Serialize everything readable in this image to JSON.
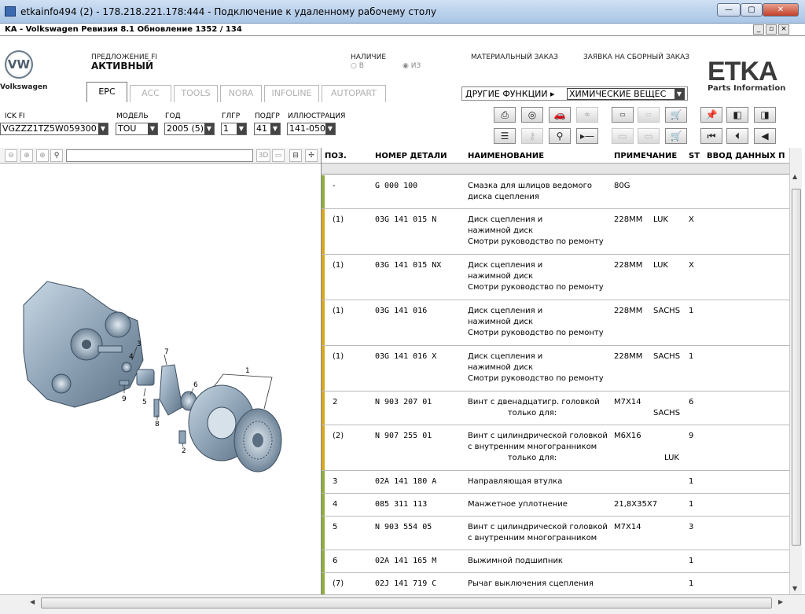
{
  "rdp": {
    "title": "etkainfo494 (2) - 178.218.221.178:444 - Подключение к удаленному рабочему столу"
  },
  "app": {
    "title": "KA - Volkswagen Ревизия 8.1 Обновление 1352 / 134"
  },
  "header": {
    "brand": "Volkswagen",
    "offer_label": "ПРЕДЛОЖЕНИЕ FI",
    "offer_value": "АКТИВНЫЙ",
    "stock_label": "НАЛИЧИЕ",
    "stock_opt_in": "В",
    "stock_opt_from": "ИЗ",
    "material_order": "МАТЕРИАЛЬНЫЙ ЗАКАЗ",
    "assembly_order": "ЗАЯВКА НА СБОРНЫЙ ЗАКАЗ",
    "logo_main": "ETKA",
    "logo_sub": "Parts Information"
  },
  "tabs": [
    "EPC",
    "ACC",
    "TOOLS",
    "NORA",
    "INFOLINE",
    "AUTOPART"
  ],
  "other_functions": {
    "label": "ДРУГИЕ ФУНКЦИИ ▸",
    "value": "ХИМИЧЕСКИЕ ВЕЩЕС"
  },
  "selectors": {
    "vin_label": "ICK FI",
    "vin_value": "VGZZZ1TZ5W059300",
    "model_label": "МОДЕЛЬ",
    "model_value": "TOU",
    "year_label": "ГОД",
    "year_value": "2005 (5)",
    "mg_label": "ГЛГР",
    "mg_value": "1",
    "sg_label": "ПОДГР",
    "sg_value": "41",
    "ill_label": "ИЛЛЮСТРАЦИЯ",
    "ill_value": "141-050"
  },
  "viewer": {
    "btn_3d": "3D"
  },
  "columns": {
    "pos": "ПОЗ.",
    "part": "НОМЕР ДЕТАЛИ",
    "name": "НАИМЕНОВАНИЕ",
    "note": "ПРИМЕЧАНИЕ",
    "st": "ST",
    "input": "ВВОД ДАННЫХ П"
  },
  "illustration_callouts": [
    "1",
    "2",
    "3",
    "4",
    "5",
    "6",
    "7",
    "8",
    "9"
  ],
  "rows": [
    {
      "pos": "-",
      "part": "G   000 100",
      "name": [
        "Смазка для шлицов ведомого",
        "диска сцепления"
      ],
      "note": "80G",
      "note2": "",
      "st": "",
      "color": "#8fae3c"
    },
    {
      "pos": "(1)",
      "part": "03G 141 015 N",
      "name": [
        "Диск сцепления и",
        "нажимной диск",
        "Смотри руководство по ремонту"
      ],
      "note": "228MM",
      "note2": "LUK",
      "st": "X",
      "color": "#d8a820"
    },
    {
      "pos": "(1)",
      "part": "03G 141 015 NX",
      "name": [
        "Диск сцепления и",
        "нажимной диск",
        "Смотри руководство по ремонту"
      ],
      "note": "228MM",
      "note2": "LUK",
      "st": "X",
      "color": "#d8a820"
    },
    {
      "pos": "(1)",
      "part": "03G 141 016",
      "name": [
        "Диск сцепления и",
        "нажимной диск",
        "Смотри руководство по ремонту"
      ],
      "note": "228MM",
      "note2": "SACHS",
      "st": "1",
      "color": "#d8a820"
    },
    {
      "pos": "(1)",
      "part": "03G 141 016  X",
      "name": [
        "Диск сцепления и",
        "нажимной диск",
        "Смотри руководство по ремонту"
      ],
      "note": "228MM",
      "note2": "SACHS",
      "st": "1",
      "color": "#d8a820"
    },
    {
      "pos": "2",
      "part": "N   903 207 01",
      "name": [
        "Винт с двенадцатигр. головкой",
        "                только для:"
      ],
      "note": "M7X14",
      "note2": "SACHS",
      "st": "6",
      "color": "#d8a820"
    },
    {
      "pos": "(2)",
      "part": "N   907 255 01",
      "name": [
        "Винт с цилиндрической головкой",
        "с внутренним многогранником",
        "                только для:"
      ],
      "note": "M6X16",
      "note2": "LUK",
      "st": "9",
      "color": "#d8a820"
    },
    {
      "pos": "3",
      "part": "02A 141 180  A",
      "name": [
        "Направляющая втулка"
      ],
      "note": "",
      "note2": "",
      "st": "1",
      "color": "#8fae3c"
    },
    {
      "pos": "4",
      "part": "085 311 113",
      "name": [
        "Манжетное уплотнение"
      ],
      "note": "21,8X35X7",
      "note2": "",
      "st": "1",
      "color": "#8fae3c"
    },
    {
      "pos": "5",
      "part": "N   903 554 05",
      "name": [
        "Винт с цилиндрической головкой",
        "с внутренним многогранником"
      ],
      "note": "M7X14",
      "note2": "",
      "st": "3",
      "color": "#8fae3c"
    },
    {
      "pos": "6",
      "part": "02A 141 165  M",
      "name": [
        "Выжимной подшипник"
      ],
      "note": "",
      "note2": "",
      "st": "1",
      "color": "#8fae3c"
    },
    {
      "pos": "(7)",
      "part": "02J 141 719  C",
      "name": [
        "Рычаг выключения сцепления"
      ],
      "note": "",
      "note2": "",
      "st": "1",
      "color": "#8fae3c"
    }
  ]
}
